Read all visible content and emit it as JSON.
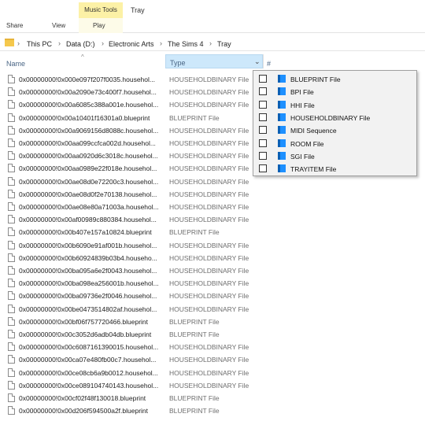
{
  "ribbon": {
    "context_group_label": "Music Tools",
    "window_title": "Tray",
    "tabs": [
      "Share",
      "View",
      "Play"
    ]
  },
  "breadcrumb": [
    "This PC",
    "Data (D:)",
    "Electronic Arts",
    "The Sims 4",
    "Tray"
  ],
  "columns": {
    "name": "Name",
    "type": "Type",
    "hash": "#"
  },
  "files": [
    {
      "name": "0x00000000!0x000e097f207f0035.househol...",
      "type": "HOUSEHOLDBINARY File"
    },
    {
      "name": "0x00000000!0x00a2090e73c400f7.househol...",
      "type": "HOUSEHOLDBINARY File"
    },
    {
      "name": "0x00000000!0x00a6085c388a001e.househol...",
      "type": "HOUSEHOLDBINARY File"
    },
    {
      "name": "0x00000000!0x00a10401f16301a0.blueprint",
      "type": "BLUEPRINT File"
    },
    {
      "name": "0x00000000!0x00a9069156d8088c.househol...",
      "type": "HOUSEHOLDBINARY File"
    },
    {
      "name": "0x00000000!0x00aa099ccfca002d.househol...",
      "type": "HOUSEHOLDBINARY File"
    },
    {
      "name": "0x00000000!0x00aa0920d6c3018c.househol...",
      "type": "HOUSEHOLDBINARY File"
    },
    {
      "name": "0x00000000!0x00aa0989e22f018e.househol...",
      "type": "HOUSEHOLDBINARY File"
    },
    {
      "name": "0x00000000!0x00ae08d0e72200c3.househol...",
      "type": "HOUSEHOLDBINARY File"
    },
    {
      "name": "0x00000000!0x00ae08d0f2e70138.househol...",
      "type": "HOUSEHOLDBINARY File"
    },
    {
      "name": "0x00000000!0x00ae08e80a71003a.househol...",
      "type": "HOUSEHOLDBINARY File"
    },
    {
      "name": "0x00000000!0x00af00989c880384.househol...",
      "type": "HOUSEHOLDBINARY File"
    },
    {
      "name": "0x00000000!0x00b407e157a10824.blueprint",
      "type": "BLUEPRINT File"
    },
    {
      "name": "0x00000000!0x00b6090e91af001b.househol...",
      "type": "HOUSEHOLDBINARY File"
    },
    {
      "name": "0x00000000!0x00b60924839b03b4.househo...",
      "type": "HOUSEHOLDBINARY File"
    },
    {
      "name": "0x00000000!0x00ba095a6e2f0043.househol...",
      "type": "HOUSEHOLDBINARY File"
    },
    {
      "name": "0x00000000!0x00ba098ea256001b.househol...",
      "type": "HOUSEHOLDBINARY File"
    },
    {
      "name": "0x00000000!0x00ba09736e2f0046.househol...",
      "type": "HOUSEHOLDBINARY File"
    },
    {
      "name": "0x00000000!0x00be0473514802af.househol...",
      "type": "HOUSEHOLDBINARY File"
    },
    {
      "name": "0x00000000!0x00bf06f757720466.blueprint",
      "type": "BLUEPRINT File"
    },
    {
      "name": "0x00000000!0x00c3052d6adb04db.blueprint",
      "type": "BLUEPRINT File"
    },
    {
      "name": "0x00000000!0x00c6087161390015.househol...",
      "type": "HOUSEHOLDBINARY File"
    },
    {
      "name": "0x00000000!0x00ca07e480fb00c7.househol...",
      "type": "HOUSEHOLDBINARY File"
    },
    {
      "name": "0x00000000!0x00ce08cb6a9b0012.househol...",
      "type": "HOUSEHOLDBINARY File"
    },
    {
      "name": "0x00000000!0x00ce089104740143.househol...",
      "type": "HOUSEHOLDBINARY File"
    },
    {
      "name": "0x00000000!0x00cf02f48f130018.blueprint",
      "type": "BLUEPRINT File"
    },
    {
      "name": "0x00000000!0x00d206f594500a2f.blueprint",
      "type": "BLUEPRINT File"
    }
  ],
  "type_filter": {
    "options": [
      {
        "label": "BLUEPRINT File",
        "checked": false
      },
      {
        "label": "BPI File",
        "checked": false
      },
      {
        "label": "HHI File",
        "checked": false
      },
      {
        "label": "HOUSEHOLDBINARY File",
        "checked": false
      },
      {
        "label": "MIDI Sequence",
        "checked": false
      },
      {
        "label": "ROOM File",
        "checked": false
      },
      {
        "label": "SGI File",
        "checked": false
      },
      {
        "label": "TRAYITEM File",
        "checked": false
      }
    ]
  },
  "colors": {
    "context_group": "#fcf1a6",
    "type_header_highlight": "#cde8fb",
    "filter_icon": "#1e90ff"
  }
}
